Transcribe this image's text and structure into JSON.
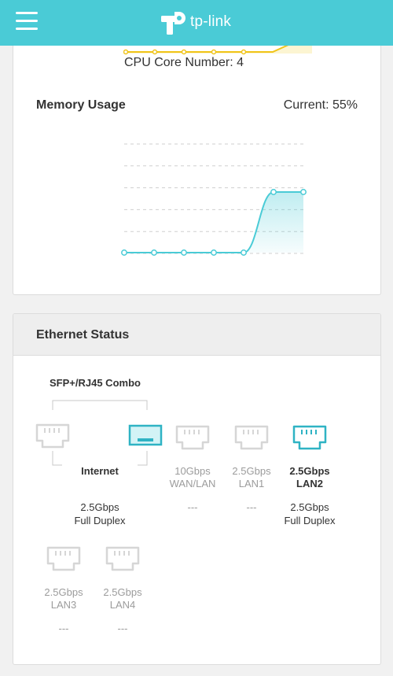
{
  "header": {
    "brand": "tp-link",
    "menu_icon": "hamburger-menu-icon",
    "logo_icon": "tp-link-logo-icon",
    "color": "#4acbd6"
  },
  "cpu": {
    "core_number_label": "CPU Core Number: 4"
  },
  "memory": {
    "title": "Memory Usage",
    "current_label": "Current: 55%",
    "chart_data": {
      "type": "area",
      "title": "Memory Usage",
      "x": [
        1,
        2,
        3,
        4,
        5,
        6,
        7
      ],
      "series": [
        {
          "values": [
            0,
            0,
            0,
            0,
            0,
            55,
            55
          ]
        }
      ],
      "ylim": [
        0,
        100
      ],
      "grid": true,
      "color": "#4acbd6"
    }
  },
  "ethernet": {
    "title": "Ethernet Status",
    "combo_label": "SFP+/RJ45 Combo",
    "internet_label": "Internet",
    "internet_status": [
      "2.5Gbps",
      "Full Duplex"
    ],
    "ports": [
      {
        "name": [
          "10Gbps",
          "WAN/LAN"
        ],
        "status": [
          "---"
        ],
        "active": false
      },
      {
        "name": [
          "2.5Gbps",
          "LAN1"
        ],
        "status": [
          "---"
        ],
        "active": false
      },
      {
        "name": [
          "2.5Gbps",
          "LAN2"
        ],
        "status": [
          "2.5Gbps",
          "Full Duplex"
        ],
        "active": true
      },
      {
        "name": [
          "2.5Gbps",
          "LAN3"
        ],
        "status": [
          "---"
        ],
        "active": false
      },
      {
        "name": [
          "2.5Gbps",
          "LAN4"
        ],
        "status": [
          "---"
        ],
        "active": false
      }
    ],
    "colors": {
      "active": "#2fb3c4",
      "inactive": "#d6d6d6"
    }
  }
}
